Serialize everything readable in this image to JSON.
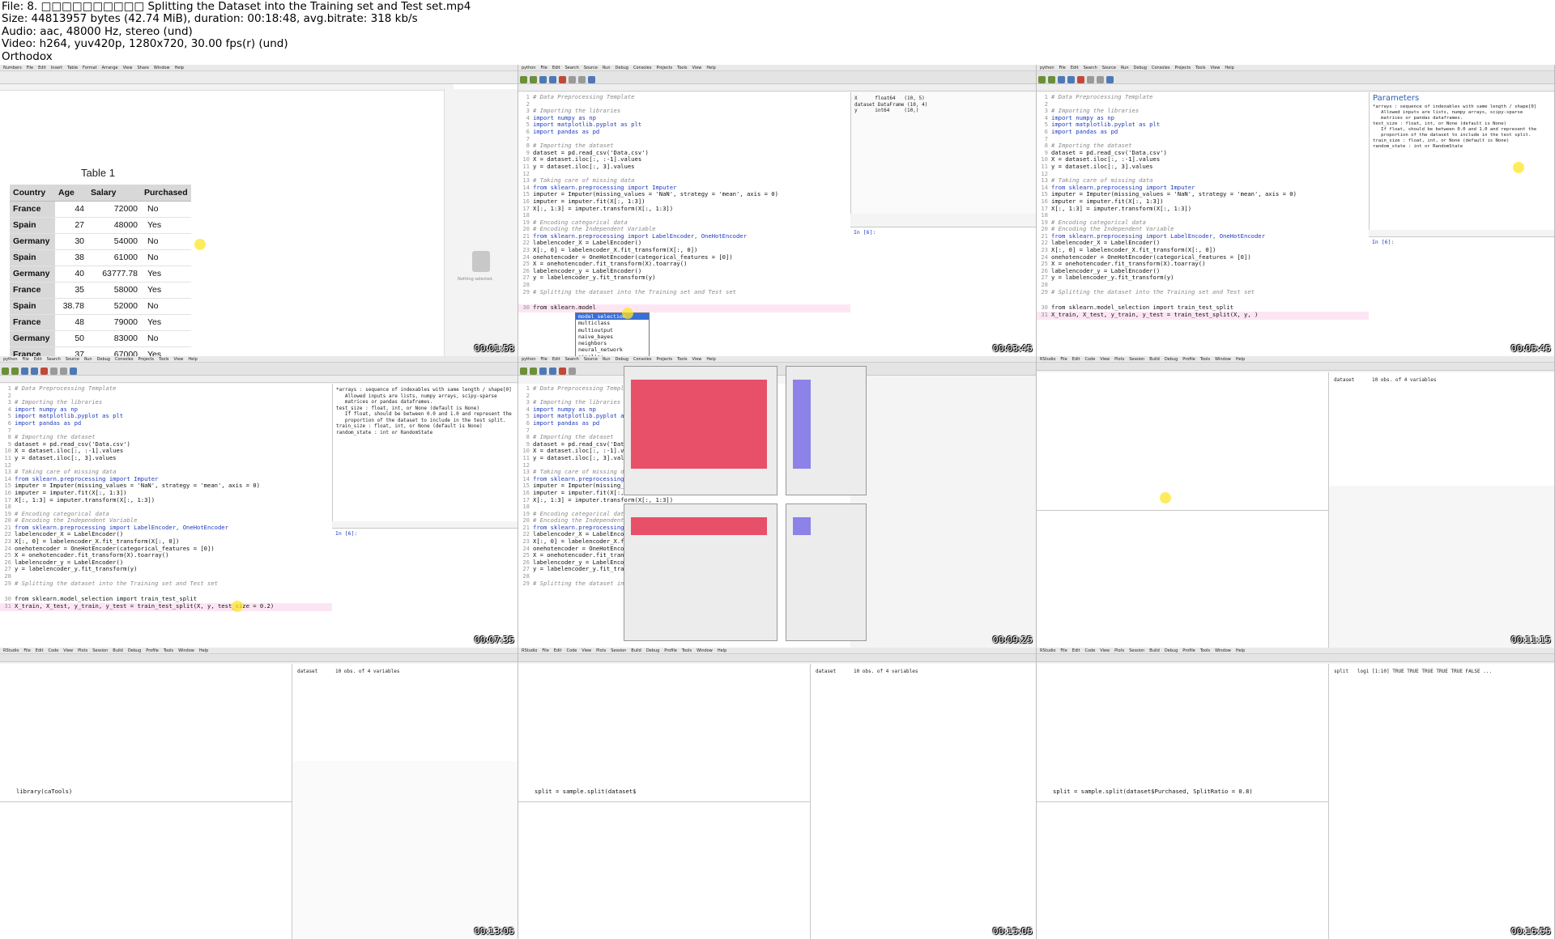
{
  "header": {
    "lines": [
      "File: 8. □□□□□□□□□□ Splitting the Dataset into the Training set and Test set.mp4",
      "Size: 44813957 bytes (42.74 MiB), duration: 00:18:48, avg.bitrate: 318 kb/s",
      "Audio: aac, 48000 Hz, stereo (und)",
      "Video: h264, yuv420p, 1280x720, 30.00 fps(r) (und)",
      "Orthodox"
    ]
  },
  "numbers": {
    "menu": [
      "Numbers",
      "File",
      "Edit",
      "Insert",
      "Table",
      "Format",
      "Arrange",
      "View",
      "Share",
      "Window",
      "Help"
    ],
    "caption": "Table 1",
    "columns": [
      "Country",
      "Age",
      "Salary",
      "Purchased"
    ],
    "rows": [
      [
        "France",
        "44",
        "72000",
        "No"
      ],
      [
        "Spain",
        "27",
        "48000",
        "Yes"
      ],
      [
        "Germany",
        "30",
        "54000",
        "No"
      ],
      [
        "Spain",
        "38",
        "61000",
        "No"
      ],
      [
        "Germany",
        "40",
        "63777.78",
        "Yes"
      ],
      [
        "France",
        "35",
        "58000",
        "Yes"
      ],
      [
        "Spain",
        "38.78",
        "52000",
        "No"
      ],
      [
        "France",
        "48",
        "79000",
        "Yes"
      ],
      [
        "Germany",
        "50",
        "83000",
        "No"
      ],
      [
        "France",
        "37",
        "67000",
        "Yes"
      ]
    ],
    "side_note": "Nothing selected.",
    "timestamp": "00:01:58"
  },
  "spyder_menu": [
    "python",
    "File",
    "Edit",
    "Search",
    "Source",
    "Run",
    "Debug",
    "Consoles",
    "Projects",
    "Tools",
    "View",
    "Help"
  ],
  "rstudio_menu": [
    "RStudio",
    "File",
    "Edit",
    "Code",
    "View",
    "Plots",
    "Session",
    "Build",
    "Debug",
    "Profile",
    "Tools",
    "Window",
    "Help"
  ],
  "python_code": [
    {
      "ln": "1",
      "t": "# Data Preprocessing Template",
      "cls": "c"
    },
    {
      "ln": "2",
      "t": "",
      "cls": ""
    },
    {
      "ln": "3",
      "t": "# Importing the libraries",
      "cls": "c"
    },
    {
      "ln": "4",
      "t": "import numpy as np",
      "cls": "k"
    },
    {
      "ln": "5",
      "t": "import matplotlib.pyplot as plt",
      "cls": "k"
    },
    {
      "ln": "6",
      "t": "import pandas as pd",
      "cls": "k"
    },
    {
      "ln": "7",
      "t": "",
      "cls": ""
    },
    {
      "ln": "8",
      "t": "# Importing the dataset",
      "cls": "c"
    },
    {
      "ln": "9",
      "t": "dataset = pd.read_csv('Data.csv')",
      "cls": ""
    },
    {
      "ln": "10",
      "t": "X = dataset.iloc[:, :-1].values",
      "cls": ""
    },
    {
      "ln": "11",
      "t": "y = dataset.iloc[:, 3].values",
      "cls": ""
    },
    {
      "ln": "12",
      "t": "",
      "cls": ""
    },
    {
      "ln": "13",
      "t": "# Taking care of missing data",
      "cls": "c"
    },
    {
      "ln": "14",
      "t": "from sklearn.preprocessing import Imputer",
      "cls": "k"
    },
    {
      "ln": "15",
      "t": "imputer = Imputer(missing_values = 'NaN', strategy = 'mean', axis = 0)",
      "cls": ""
    },
    {
      "ln": "16",
      "t": "imputer = imputer.fit(X[:, 1:3])",
      "cls": ""
    },
    {
      "ln": "17",
      "t": "X[:, 1:3] = imputer.transform(X[:, 1:3])",
      "cls": ""
    },
    {
      "ln": "18",
      "t": "",
      "cls": ""
    },
    {
      "ln": "19",
      "t": "# Encoding categorical data",
      "cls": "c"
    },
    {
      "ln": "20",
      "t": "# Encoding the Independent Variable",
      "cls": "c"
    },
    {
      "ln": "21",
      "t": "from sklearn.preprocessing import LabelEncoder, OneHotEncoder",
      "cls": "k"
    },
    {
      "ln": "22",
      "t": "labelencoder_X = LabelEncoder()",
      "cls": ""
    },
    {
      "ln": "23",
      "t": "X[:, 0] = labelencoder_X.fit_transform(X[:, 0])",
      "cls": ""
    },
    {
      "ln": "24",
      "t": "onehotencoder = OneHotEncoder(categorical_features = [0])",
      "cls": ""
    },
    {
      "ln": "25",
      "t": "X = onehotencoder.fit_transform(X).toarray()",
      "cls": ""
    },
    {
      "ln": "26",
      "t": "labelencoder_y = LabelEncoder()",
      "cls": ""
    },
    {
      "ln": "27",
      "t": "y = labelencoder_y.fit_transform(y)",
      "cls": ""
    },
    {
      "ln": "28",
      "t": "",
      "cls": ""
    },
    {
      "ln": "29",
      "t": "# Splitting the dataset into the Training set and Test set",
      "cls": "c"
    }
  ],
  "thumb2": {
    "last_line": {
      "ln": "30",
      "t": "from sklearn.model"
    },
    "autocomplete": [
      "model_selection",
      "multiclass",
      "multioutput",
      "naive_bayes",
      "neighbors",
      "neural_network",
      "pipeline"
    ],
    "console": "In [6]:",
    "varexp": [
      "X      float64   (10, 5)",
      "dataset DataFrame (10, 4)",
      "y      int64     (10,)"
    ],
    "timestamp": "00:03:45"
  },
  "thumb3": {
    "lines": [
      {
        "ln": "30",
        "t": "from sklearn.model_selection import train_test_split"
      },
      {
        "ln": "31",
        "t": "X_train, X_test, y_train, y_test = train_test_split(X, y, )"
      }
    ],
    "help_title": "Parameters",
    "help_text": [
      "*arrays : sequence of indexables with same length / shape[0]",
      "   Allowed inputs are lists, numpy arrays, scipy-sparse",
      "   matrices or pandas dataframes.",
      "test_size : float, int, or None (default is None)",
      "   If float, should be between 0.0 and 1.0 and represent the",
      "   proportion of the dataset to include in the test split.",
      "train_size : float, int, or None (default is None)",
      "random_state : int or RandomState"
    ],
    "console": "In [6]:",
    "timestamp": "00:05:45"
  },
  "thumb4": {
    "lines": [
      {
        "ln": "30",
        "t": "from sklearn.model_selection import train_test_split"
      },
      {
        "ln": "31",
        "t": "X_train, X_test, y_train, y_test = train_test_split(X, y, test_size = 0.2)"
      }
    ],
    "timestamp": "00:07:35"
  },
  "thumb5": {
    "timestamp": "00:09:25"
  },
  "thumb6": {
    "env": "dataset      10 obs. of 4 variables",
    "timestamp": "00:11:15"
  },
  "thumb7": {
    "last": "library(caTools)",
    "timestamp": "00:13:05"
  },
  "thumb8": {
    "last": "split = sample.split(dataset$",
    "timestamp": "00:15:05"
  },
  "thumb9": {
    "last": "split = sample.split(dataset$Purchased, SplitRatio = 0.8)",
    "env": "split   logi [1:10] TRUE TRUE TRUE TRUE TRUE FALSE ...",
    "timestamp": "00:16:55"
  }
}
